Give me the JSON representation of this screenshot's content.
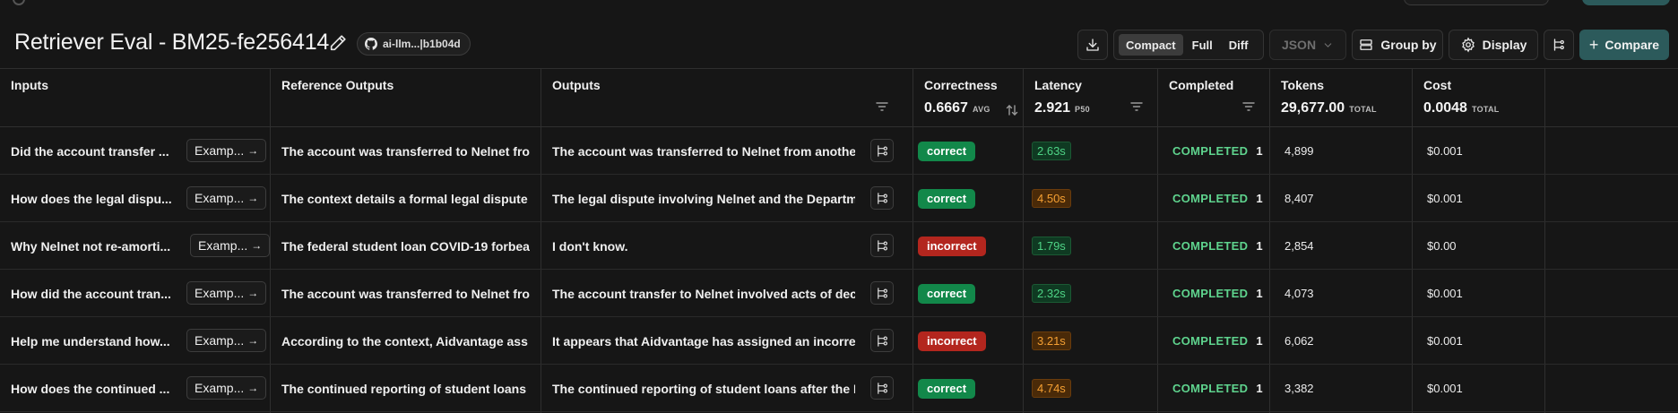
{
  "header": {
    "title": "Retriever Eval - BM25-fe256414",
    "commit": "ai-llm...|b1b04d",
    "view_modes": [
      "Compact",
      "Full",
      "Diff"
    ],
    "active_view": "Compact",
    "format": "JSON",
    "group_by_label": "Group by",
    "display_label": "Display",
    "compare_label": "Compare"
  },
  "columns": {
    "inputs": "Inputs",
    "reference": "Reference Outputs",
    "outputs": "Outputs",
    "correctness": {
      "label": "Correctness",
      "value": "0.6667",
      "unit": "AVG"
    },
    "latency": {
      "label": "Latency",
      "value": "2.921",
      "unit": "P50"
    },
    "completed": {
      "label": "Completed"
    },
    "tokens": {
      "label": "Tokens",
      "value": "29,677.00",
      "unit": "TOTAL"
    },
    "cost": {
      "label": "Cost",
      "value": "0.0048",
      "unit": "TOTAL"
    }
  },
  "example_label": "Examp...",
  "rows": [
    {
      "input": "Did the account transfer ...",
      "reference": "The account was transferred to Nelnet fro",
      "output": "The account was transferred to Nelnet from another",
      "correctness": "correct",
      "latency": "2.63s",
      "latency_level": "fast",
      "status": "COMPLETED",
      "status_count": "1",
      "tokens": "4,899",
      "cost": "$0.001"
    },
    {
      "input": "How does the legal dispu...",
      "reference": "The context details a formal legal dispute",
      "output": "The legal dispute involving Nelnet and the Departmen",
      "correctness": "correct",
      "latency": "4.50s",
      "latency_level": "slow",
      "status": "COMPLETED",
      "status_count": "1",
      "tokens": "8,407",
      "cost": "$0.001"
    },
    {
      "input": "Why Nelnet not re-amorti...",
      "reference": "The federal student loan COVID-19 forbea",
      "output": "I don't know.",
      "correctness": "incorrect",
      "latency": "1.79s",
      "latency_level": "fast",
      "status": "COMPLETED",
      "status_count": "1",
      "tokens": "2,854",
      "cost": "$0.00"
    },
    {
      "input": "How did the account tran...",
      "reference": "The account was transferred to Nelnet fro",
      "output": "The account transfer to Nelnet involved acts of decep",
      "correctness": "correct",
      "latency": "2.32s",
      "latency_level": "fast",
      "status": "COMPLETED",
      "status_count": "1",
      "tokens": "4,073",
      "cost": "$0.001"
    },
    {
      "input": "Help me understand how...",
      "reference": "According to the context, Aidvantage ass",
      "output": "It appears that Aidvantage has assigned an incorrect",
      "correctness": "incorrect",
      "latency": "3.21s",
      "latency_level": "slow",
      "status": "COMPLETED",
      "status_count": "1",
      "tokens": "6,062",
      "cost": "$0.001"
    },
    {
      "input": "How does the continued ...",
      "reference": "The continued reporting of student loans",
      "output": "The continued reporting of student loans after the De",
      "correctness": "correct",
      "latency": "4.74s",
      "latency_level": "slow",
      "status": "COMPLETED",
      "status_count": "1",
      "tokens": "3,382",
      "cost": "$0.001"
    }
  ],
  "colors": {
    "accent": "#2c5a5b",
    "correct": "#12884a",
    "incorrect": "#b3261e",
    "completed": "#5fd48e"
  },
  "icons": [
    "edit-icon",
    "github-icon",
    "download-icon",
    "chevron-down-icon",
    "group-by-icon",
    "gear-icon",
    "compare-traces-icon",
    "plus-icon",
    "filter-icon",
    "sort-icon",
    "arrow-right-icon",
    "trace-icon"
  ]
}
